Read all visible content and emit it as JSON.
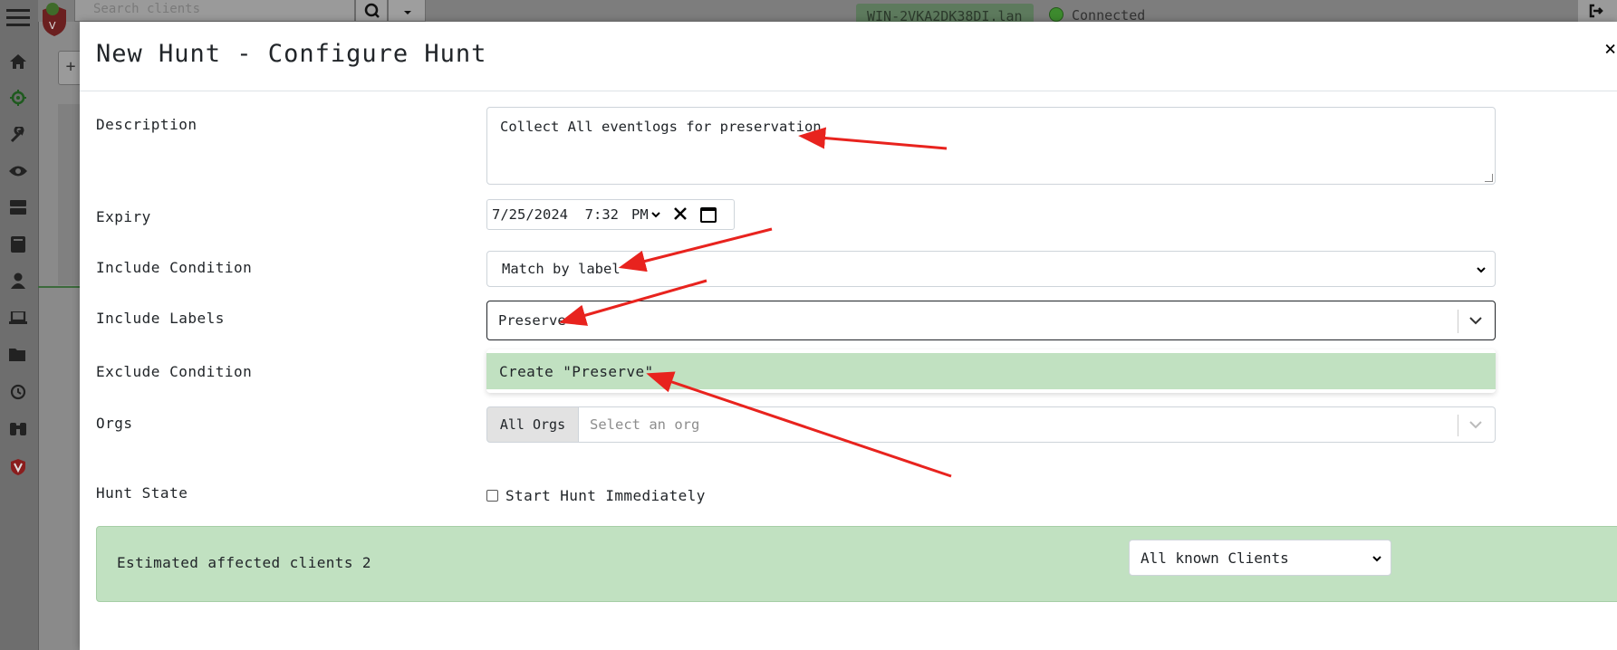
{
  "app": {
    "search_placeholder": "Search clients",
    "hostname": "WIN-2VKA2DK38DI.lan",
    "connection_status": "Connected",
    "status_color": "#3d8a2e",
    "nav_icons": [
      "home-icon",
      "crosshair-icon",
      "wrench-icon",
      "eye-icon",
      "server-icon",
      "book-icon",
      "user-icon",
      "laptop-icon",
      "folder-icon",
      "history-icon",
      "binoculars-icon",
      "velociraptor-shield-icon"
    ]
  },
  "modal": {
    "title": "New Hunt - Configure Hunt",
    "close_symbol": "×",
    "fields": {
      "description_label": "Description",
      "description_value": "Collect All eventlogs for preservation",
      "expiry_label": "Expiry",
      "expiry_value": "7/25/2024  7:32",
      "expiry_ampm": "PM",
      "include_condition_label": "Include Condition",
      "include_condition_value": "Match by label",
      "include_labels_label": "Include Labels",
      "include_labels_value": "Preserve",
      "create_option": "Create \"Preserve\"",
      "exclude_condition_label": "Exclude Condition",
      "orgs_label": "Orgs",
      "orgs_addon": "All Orgs",
      "orgs_placeholder": "Select an org",
      "hunt_state_label": "Hunt State",
      "start_immediately_label": "Start Hunt Immediately"
    },
    "estimate": {
      "text": "Estimated affected clients 2",
      "scope_value": "All known Clients",
      "bg_color": "#c1e1c1"
    }
  },
  "annotation_color": "#e8231e"
}
